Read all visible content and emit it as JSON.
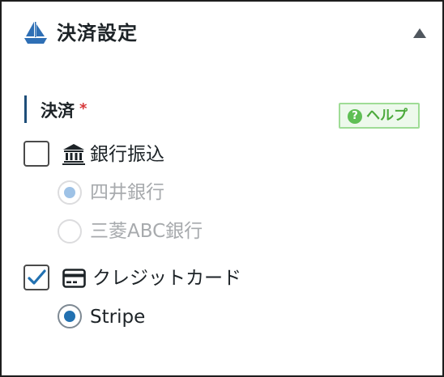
{
  "panel": {
    "title": "決済設定",
    "header_icon": "sailboat-icon",
    "collapse_icon": "triangle-up-icon"
  },
  "section": {
    "label": "決済",
    "required_mark": "*",
    "help_label": "ヘルプ",
    "help_icon_glyph": "?"
  },
  "options": {
    "bank_transfer": {
      "label": "銀行振込",
      "checked": false,
      "icon": "bank-icon",
      "banks": [
        {
          "label": "四井銀行",
          "selected": true,
          "disabled": true
        },
        {
          "label": "三菱ABC銀行",
          "selected": false,
          "disabled": true
        }
      ]
    },
    "credit_card": {
      "label": "クレジットカード",
      "checked": true,
      "icon": "credit-card-icon",
      "providers": [
        {
          "label": "Stripe",
          "selected": true,
          "disabled": false
        }
      ]
    }
  },
  "colors": {
    "accent": "#2271b1",
    "section_bar": "#1e4e79",
    "required": "#d63638",
    "help_green": "#4caa3c",
    "disabled_text": "#a7aaad",
    "header_icon": "#2e6fb5"
  }
}
